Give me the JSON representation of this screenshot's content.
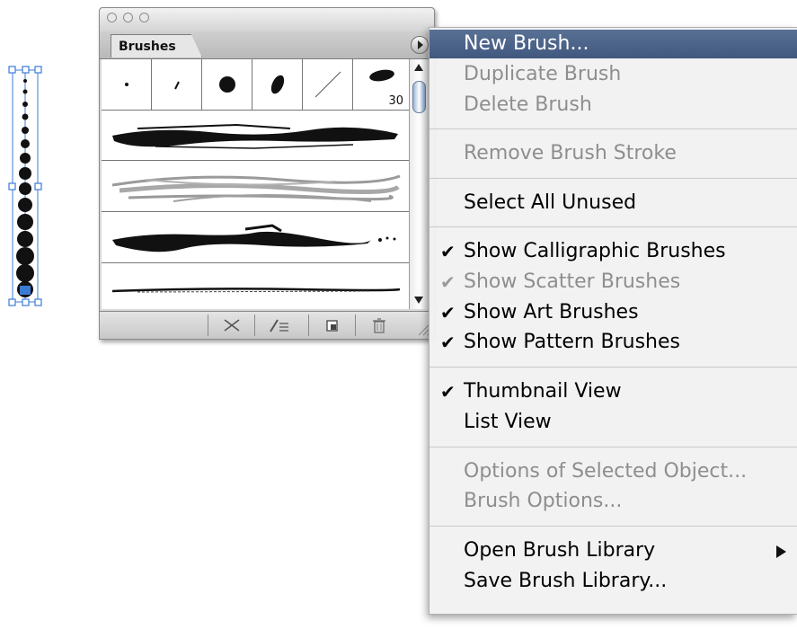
{
  "panel": {
    "tab_label": "Brushes",
    "calligraphic_size_label": "30"
  },
  "menu": {
    "new_brush": "New Brush...",
    "duplicate_brush": "Duplicate Brush",
    "delete_brush": "Delete Brush",
    "remove_brush_stroke": "Remove Brush Stroke",
    "select_all_unused": "Select All Unused",
    "show_calligraphic": "Show Calligraphic Brushes",
    "show_scatter": "Show Scatter Brushes",
    "show_art": "Show Art Brushes",
    "show_pattern": "Show Pattern Brushes",
    "thumbnail_view": "Thumbnail View",
    "list_view": "List View",
    "options_selected_object": "Options of Selected Object...",
    "brush_options": "Brush Options...",
    "open_brush_library": "Open Brush Library",
    "save_brush_library": "Save Brush Library...",
    "check_glyph": "✔"
  },
  "colors": {
    "highlight": "#4a6188",
    "selection": "#3b7bd4"
  }
}
